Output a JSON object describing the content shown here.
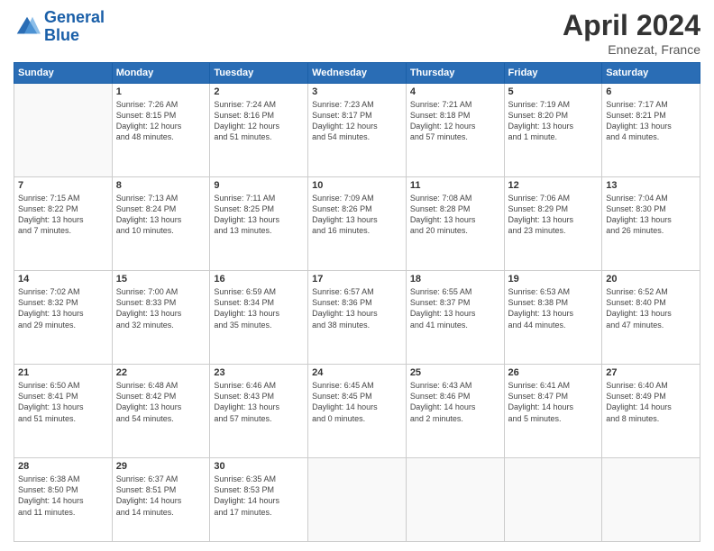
{
  "header": {
    "logo_line1": "General",
    "logo_line2": "Blue",
    "month": "April 2024",
    "location": "Ennezat, France"
  },
  "days_of_week": [
    "Sunday",
    "Monday",
    "Tuesday",
    "Wednesday",
    "Thursday",
    "Friday",
    "Saturday"
  ],
  "weeks": [
    [
      {
        "day": "",
        "info": ""
      },
      {
        "day": "1",
        "info": "Sunrise: 7:26 AM\nSunset: 8:15 PM\nDaylight: 12 hours\nand 48 minutes."
      },
      {
        "day": "2",
        "info": "Sunrise: 7:24 AM\nSunset: 8:16 PM\nDaylight: 12 hours\nand 51 minutes."
      },
      {
        "day": "3",
        "info": "Sunrise: 7:23 AM\nSunset: 8:17 PM\nDaylight: 12 hours\nand 54 minutes."
      },
      {
        "day": "4",
        "info": "Sunrise: 7:21 AM\nSunset: 8:18 PM\nDaylight: 12 hours\nand 57 minutes."
      },
      {
        "day": "5",
        "info": "Sunrise: 7:19 AM\nSunset: 8:20 PM\nDaylight: 13 hours\nand 1 minute."
      },
      {
        "day": "6",
        "info": "Sunrise: 7:17 AM\nSunset: 8:21 PM\nDaylight: 13 hours\nand 4 minutes."
      }
    ],
    [
      {
        "day": "7",
        "info": "Sunrise: 7:15 AM\nSunset: 8:22 PM\nDaylight: 13 hours\nand 7 minutes."
      },
      {
        "day": "8",
        "info": "Sunrise: 7:13 AM\nSunset: 8:24 PM\nDaylight: 13 hours\nand 10 minutes."
      },
      {
        "day": "9",
        "info": "Sunrise: 7:11 AM\nSunset: 8:25 PM\nDaylight: 13 hours\nand 13 minutes."
      },
      {
        "day": "10",
        "info": "Sunrise: 7:09 AM\nSunset: 8:26 PM\nDaylight: 13 hours\nand 16 minutes."
      },
      {
        "day": "11",
        "info": "Sunrise: 7:08 AM\nSunset: 8:28 PM\nDaylight: 13 hours\nand 20 minutes."
      },
      {
        "day": "12",
        "info": "Sunrise: 7:06 AM\nSunset: 8:29 PM\nDaylight: 13 hours\nand 23 minutes."
      },
      {
        "day": "13",
        "info": "Sunrise: 7:04 AM\nSunset: 8:30 PM\nDaylight: 13 hours\nand 26 minutes."
      }
    ],
    [
      {
        "day": "14",
        "info": "Sunrise: 7:02 AM\nSunset: 8:32 PM\nDaylight: 13 hours\nand 29 minutes."
      },
      {
        "day": "15",
        "info": "Sunrise: 7:00 AM\nSunset: 8:33 PM\nDaylight: 13 hours\nand 32 minutes."
      },
      {
        "day": "16",
        "info": "Sunrise: 6:59 AM\nSunset: 8:34 PM\nDaylight: 13 hours\nand 35 minutes."
      },
      {
        "day": "17",
        "info": "Sunrise: 6:57 AM\nSunset: 8:36 PM\nDaylight: 13 hours\nand 38 minutes."
      },
      {
        "day": "18",
        "info": "Sunrise: 6:55 AM\nSunset: 8:37 PM\nDaylight: 13 hours\nand 41 minutes."
      },
      {
        "day": "19",
        "info": "Sunrise: 6:53 AM\nSunset: 8:38 PM\nDaylight: 13 hours\nand 44 minutes."
      },
      {
        "day": "20",
        "info": "Sunrise: 6:52 AM\nSunset: 8:40 PM\nDaylight: 13 hours\nand 47 minutes."
      }
    ],
    [
      {
        "day": "21",
        "info": "Sunrise: 6:50 AM\nSunset: 8:41 PM\nDaylight: 13 hours\nand 51 minutes."
      },
      {
        "day": "22",
        "info": "Sunrise: 6:48 AM\nSunset: 8:42 PM\nDaylight: 13 hours\nand 54 minutes."
      },
      {
        "day": "23",
        "info": "Sunrise: 6:46 AM\nSunset: 8:43 PM\nDaylight: 13 hours\nand 57 minutes."
      },
      {
        "day": "24",
        "info": "Sunrise: 6:45 AM\nSunset: 8:45 PM\nDaylight: 14 hours\nand 0 minutes."
      },
      {
        "day": "25",
        "info": "Sunrise: 6:43 AM\nSunset: 8:46 PM\nDaylight: 14 hours\nand 2 minutes."
      },
      {
        "day": "26",
        "info": "Sunrise: 6:41 AM\nSunset: 8:47 PM\nDaylight: 14 hours\nand 5 minutes."
      },
      {
        "day": "27",
        "info": "Sunrise: 6:40 AM\nSunset: 8:49 PM\nDaylight: 14 hours\nand 8 minutes."
      }
    ],
    [
      {
        "day": "28",
        "info": "Sunrise: 6:38 AM\nSunset: 8:50 PM\nDaylight: 14 hours\nand 11 minutes."
      },
      {
        "day": "29",
        "info": "Sunrise: 6:37 AM\nSunset: 8:51 PM\nDaylight: 14 hours\nand 14 minutes."
      },
      {
        "day": "30",
        "info": "Sunrise: 6:35 AM\nSunset: 8:53 PM\nDaylight: 14 hours\nand 17 minutes."
      },
      {
        "day": "",
        "info": ""
      },
      {
        "day": "",
        "info": ""
      },
      {
        "day": "",
        "info": ""
      },
      {
        "day": "",
        "info": ""
      }
    ]
  ]
}
